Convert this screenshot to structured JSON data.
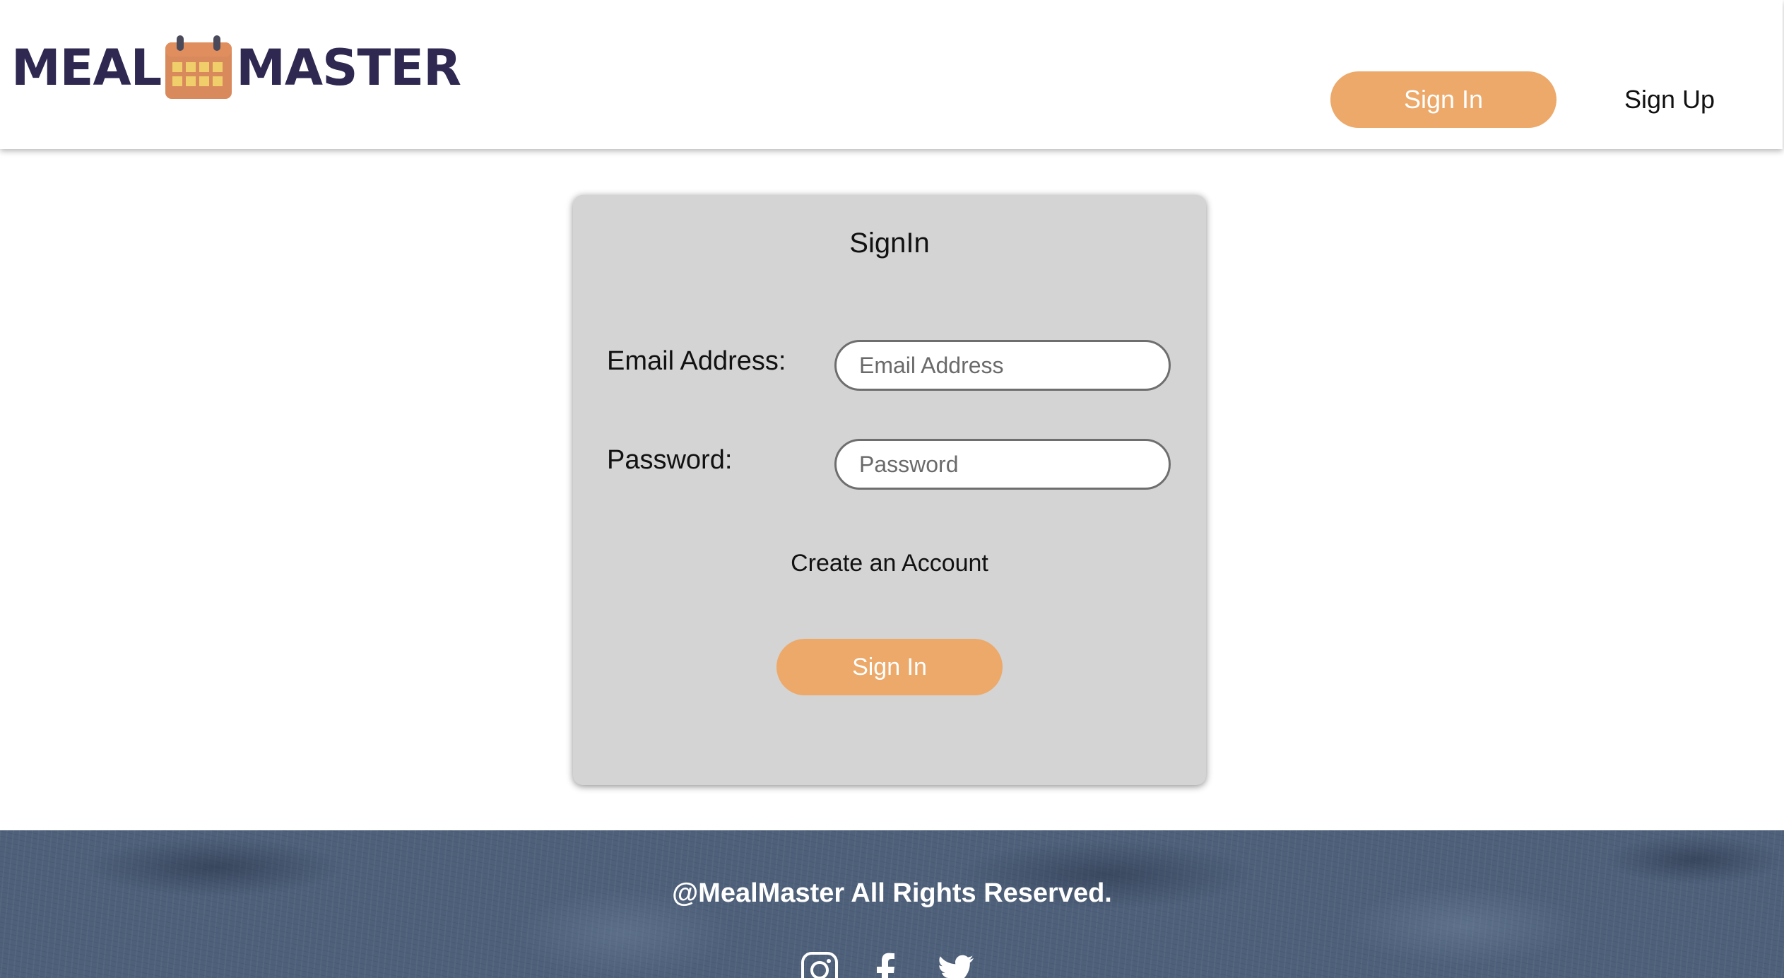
{
  "brand": {
    "name_left": "MEAL",
    "name_right": "MASTER",
    "logo_icon": "calendar-icon",
    "colors": {
      "brand_text": "#2f2850",
      "accent": "#eca96a",
      "card_background": "#d4d4d4"
    }
  },
  "nav": {
    "signin_label": "Sign In",
    "signup_label": "Sign Up"
  },
  "signin_card": {
    "title": "SignIn",
    "email": {
      "label": "Email Address:",
      "placeholder": "Email Address",
      "value": ""
    },
    "password": {
      "label": "Password:",
      "placeholder": "Password",
      "value": ""
    },
    "create_account_label": "Create an Account",
    "submit_label": "Sign In"
  },
  "footer": {
    "copyright": "@MealMaster All Rights Reserved.",
    "social_icons": [
      "instagram-icon",
      "facebook-icon",
      "twitter-icon"
    ]
  }
}
